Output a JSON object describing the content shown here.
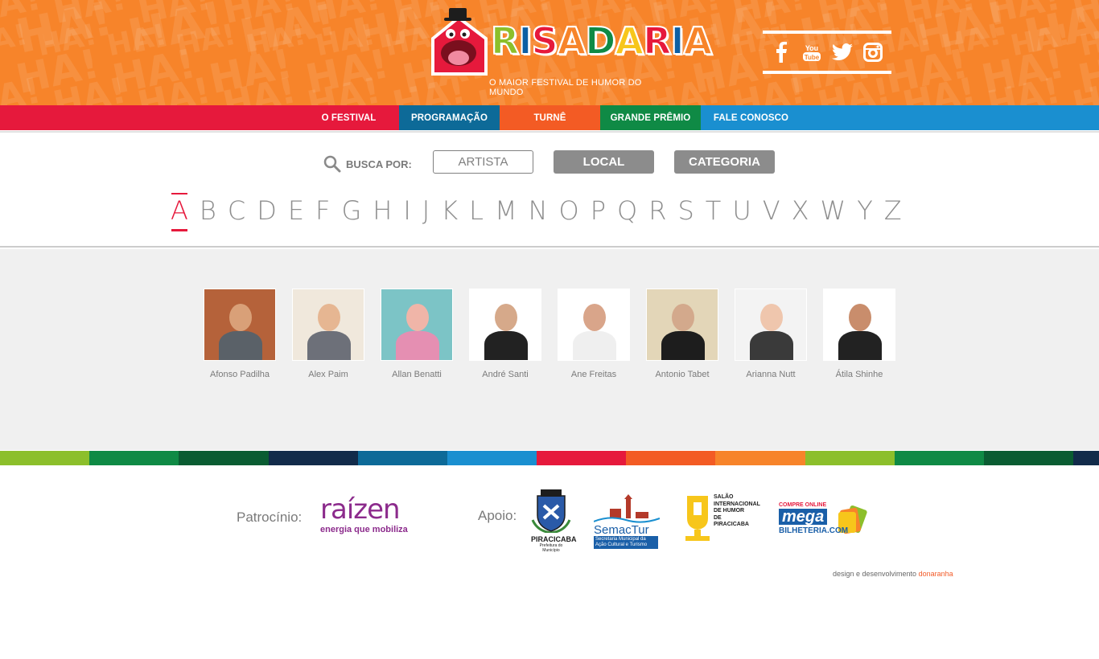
{
  "header": {
    "ha_text": "HA!",
    "logo": {
      "letters": [
        "R",
        "I",
        "S",
        "A",
        "D",
        "A",
        "R",
        "I",
        "A"
      ],
      "colors": [
        "#8cbf2b",
        "#0c5fa3",
        "#e6193c",
        "#f7842a",
        "#0f8a45",
        "#f7c61b",
        "#e6193c",
        "#0c5fa3",
        "#f7842a"
      ],
      "tagline": "O MAIOR FESTIVAL DE HUMOR DO MUNDO"
    },
    "social": [
      {
        "name": "facebook-icon"
      },
      {
        "name": "youtube-icon",
        "label": "You Tube"
      },
      {
        "name": "twitter-icon"
      },
      {
        "name": "instagram-icon"
      }
    ]
  },
  "nav": {
    "items": [
      {
        "label": "O FESTIVAL",
        "color": "#e6193c"
      },
      {
        "label": "PROGRAMAÇÃO",
        "color": "#0d6a98"
      },
      {
        "label": "TURNÊ",
        "color": "#f35b24"
      },
      {
        "label": "GRANDE PRÊMIO",
        "color": "#0f8a45"
      },
      {
        "label": "FALE CONOSCO",
        "color": "#1a8fd0"
      }
    ]
  },
  "search": {
    "label": "BUSCA POR:",
    "buttons": {
      "artista": "ARTISTA",
      "local": "LOCAL",
      "categoria": "CATEGORIA"
    },
    "letters": [
      "A",
      "B",
      "C",
      "D",
      "E",
      "F",
      "G",
      "H",
      "I",
      "J",
      "K",
      "L",
      "M",
      "N",
      "O",
      "P",
      "Q",
      "R",
      "S",
      "T",
      "U",
      "V",
      "X",
      "W",
      "Y",
      "Z"
    ],
    "active_letter": "A"
  },
  "artists": [
    {
      "name": "Afonso Padilha",
      "bg": "#b5623a",
      "skin": "#d9a078",
      "cloth": "#5a6168"
    },
    {
      "name": "Alex Paim",
      "bg": "#f0e8dc",
      "skin": "#e6b692",
      "cloth": "#6d7079"
    },
    {
      "name": "Allan Benatti",
      "bg": "#7cc4c6",
      "skin": "#f0b5a8",
      "cloth": "#e58fb2"
    },
    {
      "name": "André Santi",
      "bg": "#ffffff",
      "skin": "#d6a98a",
      "cloth": "#222222"
    },
    {
      "name": "Ane Freitas",
      "bg": "#ffffff",
      "skin": "#d9a58a",
      "cloth": "#efefef"
    },
    {
      "name": "Antonio Tabet",
      "bg": "#e3d6b8",
      "skin": "#d3a98c",
      "cloth": "#1d1d1d"
    },
    {
      "name": "Arianna Nutt",
      "bg": "#f3f3f3",
      "skin": "#efc6ad",
      "cloth": "#3a3a3a"
    },
    {
      "name": "Átila Shinhe",
      "bg": "#ffffff",
      "skin": "#c98d6c",
      "cloth": "#222222"
    }
  ],
  "stripe_colors": [
    "#8cbf2b",
    "#0f8a45",
    "#0a5c32",
    "#122b4a",
    "#0d6a98",
    "#1a8fd0",
    "#e6193c",
    "#f35b24",
    "#f7842a",
    "#8cbf2b",
    "#0f8a45",
    "#0a5c32",
    "#122b4a"
  ],
  "footer": {
    "patrocinio_label": "Patrocínio:",
    "raizen_word": "raízen",
    "raizen_tagline": "energia que mobiliza",
    "apoio_label": "Apoio:",
    "supporters": [
      {
        "name": "piracicaba-logo",
        "title": "PIRACICABA",
        "sub": "Prefeitura do Município"
      },
      {
        "name": "semactur-logo",
        "title": "SemacTur",
        "sub": "Secretaria Municipal da Ação Cultural e Turismo"
      },
      {
        "name": "salao-humor-logo",
        "title": "SALÃO INTERNACIONAL DE HUMOR DE PIRACICABA"
      },
      {
        "name": "megabilheteria-logo",
        "top": "COMPRE ONLINE",
        "title": "mega",
        "sub": "BILHETERIA.COM"
      }
    ],
    "credit_text": "design e desenvolvimento",
    "credit_accent": "donaranha"
  }
}
